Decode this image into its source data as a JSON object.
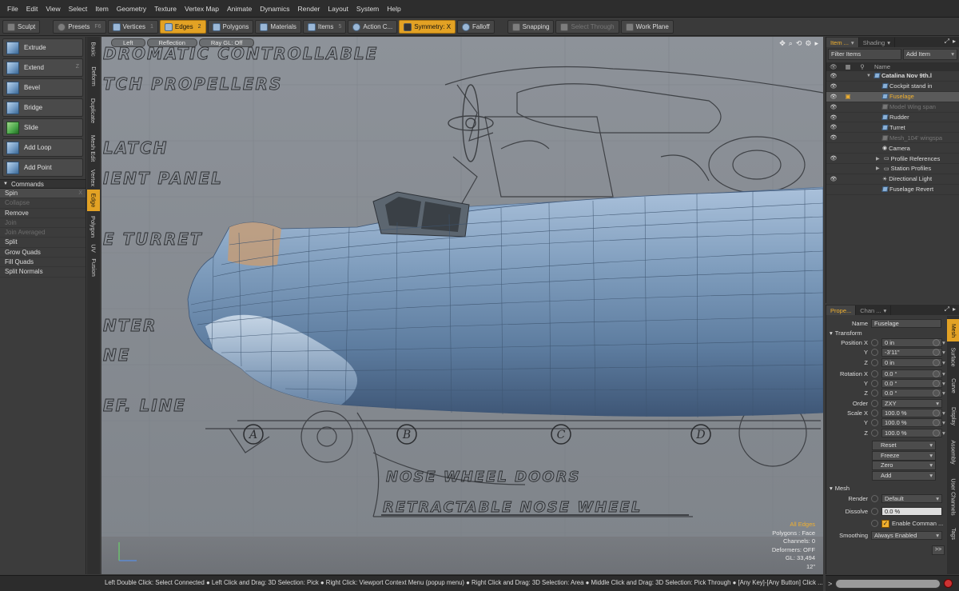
{
  "menu": [
    "File",
    "Edit",
    "View",
    "Select",
    "Item",
    "Geometry",
    "Texture",
    "Vertex Map",
    "Animate",
    "Dynamics",
    "Render",
    "Layout",
    "System",
    "Help"
  ],
  "toolbar": {
    "sculpt": "Sculpt",
    "presets": "Presets",
    "presets_key": "F6",
    "vertices": "Vertices",
    "vertices_key": "1",
    "edges": "Edges",
    "edges_key": "2",
    "polygons": "Polygons",
    "materials": "Materials",
    "items": "Items",
    "items_key": "5",
    "action_center": "Action C...",
    "symmetry": "Symmetry: X",
    "falloff": "Falloff",
    "snapping": "Snapping",
    "select_through": "Select Through",
    "work_plane": "Work Plane"
  },
  "tools": [
    {
      "label": "Extrude",
      "key": ""
    },
    {
      "label": "Extend",
      "key": "Z"
    },
    {
      "label": "Bevel",
      "key": ""
    },
    {
      "label": "Bridge",
      "key": ""
    },
    {
      "label": "Slide",
      "key": ""
    },
    {
      "label": "Add Loop",
      "key": ""
    },
    {
      "label": "Add Point",
      "key": ""
    }
  ],
  "commands_header": "Commands",
  "commands": [
    {
      "label": "Spin",
      "enabled": true,
      "key": "X"
    },
    {
      "label": "Collapse",
      "enabled": false,
      "key": ""
    },
    {
      "label": "Remove",
      "enabled": true,
      "key": ""
    },
    {
      "label": "Join",
      "enabled": false,
      "key": ""
    },
    {
      "label": "Join Averaged",
      "enabled": false,
      "key": ""
    },
    {
      "label": "Split",
      "enabled": true,
      "key": ""
    },
    {
      "label": "Grow Quads",
      "enabled": true,
      "key": ""
    },
    {
      "label": "Fill Quads",
      "enabled": true,
      "key": ""
    },
    {
      "label": "Split Normals",
      "enabled": true,
      "key": ""
    }
  ],
  "vertical_tabs": [
    "Basic",
    "Deform",
    "Duplicate",
    "Mesh Edit",
    "Vertex",
    "Edge",
    "Polygon",
    "UV",
    "Fusion"
  ],
  "active_vertical_tab": "Edge",
  "viewport": {
    "header_buttons": [
      "Left",
      "Reflection",
      "Ray GL: Off"
    ],
    "drawing_text": [
      "DROMATIC CONTROLLABLE",
      "TCH PROPELLERS",
      "LATCH",
      "IENT PANEL",
      "E TURRET",
      "NTER",
      "NE",
      "EF. LINE",
      "NOSE WHEEL DOORS",
      "RETRACTABLE NOSE WHEEL"
    ],
    "station_labels": [
      "A",
      "B",
      "C",
      "D"
    ],
    "stats": {
      "selection": "All Edges",
      "polygons": "Polygons : Face",
      "channels": "Channels: 0",
      "deformers": "Deformers: OFF",
      "gl": "GL: 33,494",
      "unit": "12\""
    }
  },
  "item_list": {
    "tabs": [
      "Item ...",
      "Shading"
    ],
    "filter": "Filter Items",
    "add_item": "Add Item",
    "name_header": "Name",
    "rows": [
      {
        "label": "Catalina Nov 9th.l",
        "visible": true,
        "state": "scene"
      },
      {
        "label": "Cockpit stand in",
        "visible": true,
        "state": "mesh"
      },
      {
        "label": "Fuselage",
        "visible": true,
        "state": "selected"
      },
      {
        "label": "Model Wing span",
        "visible": true,
        "state": "disabled"
      },
      {
        "label": "Rudder",
        "visible": true,
        "state": "mesh"
      },
      {
        "label": "Turret",
        "visible": true,
        "state": "mesh"
      },
      {
        "label": "Mesh_104' wingspa",
        "visible": true,
        "state": "disabled"
      },
      {
        "label": "Camera",
        "visible": false,
        "state": "camera"
      },
      {
        "label": "Profile References",
        "visible": true,
        "state": "group"
      },
      {
        "label": "Station Profiles",
        "visible": false,
        "state": "group"
      },
      {
        "label": "Directional Light",
        "visible": true,
        "state": "light"
      },
      {
        "label": "Fuselage Revert",
        "visible": false,
        "state": "mesh"
      }
    ]
  },
  "properties": {
    "tabs": [
      "Prope...",
      "Chan ..."
    ],
    "name_label": "Name",
    "name_value": "Fuselage",
    "transform_header": "Transform",
    "position": [
      {
        "axis": "Position X",
        "value": "0 in"
      },
      {
        "axis": "Y",
        "value": "-3'11\""
      },
      {
        "axis": "Z",
        "value": "0 in"
      }
    ],
    "rotation": [
      {
        "axis": "Rotation X",
        "value": "0.0 °"
      },
      {
        "axis": "Y",
        "value": "0.0 °"
      },
      {
        "axis": "Z",
        "value": "0.0 °"
      }
    ],
    "order_label": "Order",
    "order_value": "ZXY",
    "scale": [
      {
        "axis": "Scale X",
        "value": "100.0 %"
      },
      {
        "axis": "Y",
        "value": "100.0 %"
      },
      {
        "axis": "Z",
        "value": "100.0 %"
      }
    ],
    "buttons": [
      "Reset",
      "Freeze",
      "Zero",
      "Add"
    ],
    "mesh_header": "Mesh",
    "render_label": "Render",
    "render_value": "Default",
    "dissolve_label": "Dissolve",
    "dissolve_value": "0.0 %",
    "enable_command": "Enable Comman ...",
    "smoothing_label": "Smoothing",
    "smoothing_value": "Always Enabled",
    "more": ">>"
  },
  "prop_vertical_tabs": [
    "Mesh",
    "Surface",
    "Curve",
    "Display",
    "Assembly",
    "User Channels",
    "Tags"
  ],
  "active_prop_tab": "Mesh",
  "status_bar": "Left Double Click: Select Connected ● Left Click and Drag: 3D Selection: Pick ● Right Click: Viewport Context Menu (popup menu) ● Right Click and Drag: 3D Selection: Area ● Middle Click and Drag: 3D Selection: Pick Through ● [Any Key]-[Any Button] Click ...",
  "colors": {
    "accent": "#e3a224",
    "panel": "#3a3a3a",
    "fuselage": "#7d9cc0"
  }
}
